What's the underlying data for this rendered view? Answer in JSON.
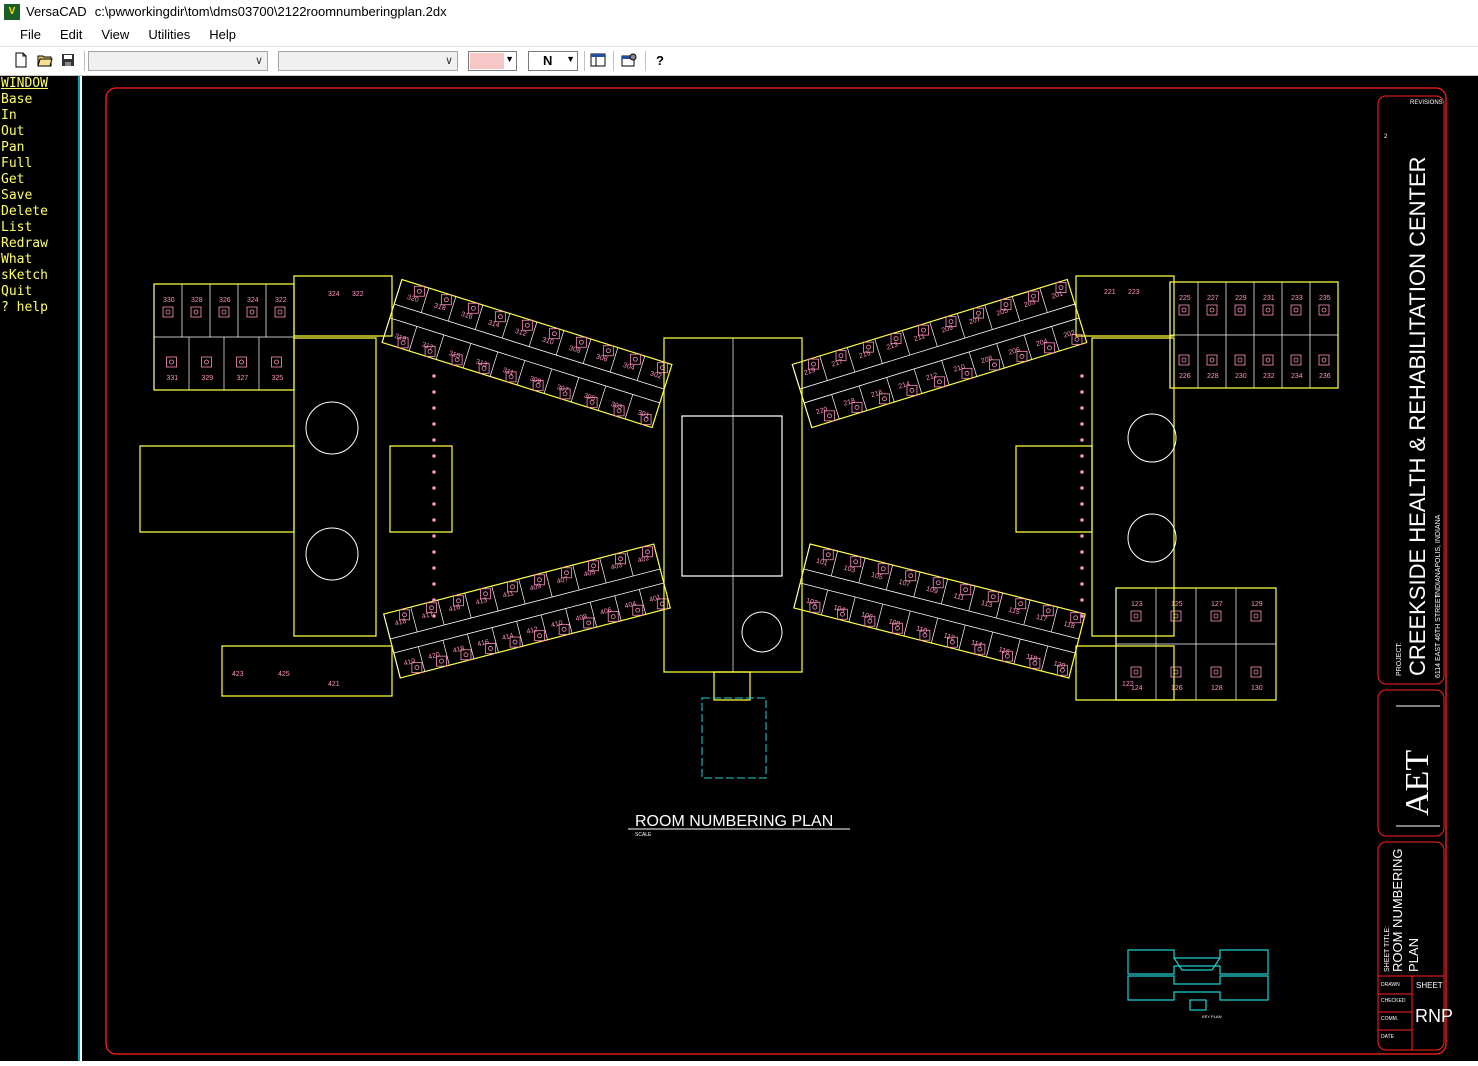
{
  "window": {
    "app_name": "VersaCAD",
    "file_path": "c:\\pwworkingdir\\tom\\dms03700\\2122roomnumberingplan.2dx"
  },
  "menu": [
    "File",
    "Edit",
    "View",
    "Utilities",
    "Help"
  ],
  "toolbar": {
    "layer_select": "",
    "pen_select": "",
    "color_swatch": "#f7c7c7",
    "n_value": "N",
    "icons": [
      "new-file-icon",
      "open-folder-icon",
      "save-icon",
      "layer-table-icon",
      "settings-icon",
      "help-icon"
    ]
  },
  "commands": [
    "WINDOW",
    "Base",
    "In",
    "Out",
    "Pan",
    "Full",
    "Get",
    "Save",
    "Delete",
    "List",
    "Redraw",
    "What",
    "sKetch",
    "Quit",
    "? help"
  ],
  "drawing": {
    "plan_title": "ROOM NUMBERING PLAN",
    "plan_scale_note": "SCALE",
    "project_label": "PROJECT:",
    "project_name": "CREEKSIDE HEALTH & REHABILITATION CENTER",
    "project_address_1": "6114 EAST 46TH STREET",
    "project_address_2": "INDIANAPOLIS, INDIANA",
    "revisions_label": "REVISIONS",
    "revision_mark": "2",
    "firm_logo": "AET",
    "sheet_title_label": "SHEET TITLE:",
    "sheet_title": "ROOM NUMBERING PLAN",
    "sheet_label": "SHEET",
    "sheet_id": "RNP",
    "drawn_label": "DRAWN",
    "checked_label": "CHECKED",
    "comm_label": "COMM.",
    "date_label": "DATE",
    "key_plan_caption": "KEY PLAN",
    "colors": {
      "background": "#000000",
      "border": "#ff2020",
      "walls": "#ffff40",
      "rooms": "#ffffff",
      "fixtures": "#ff90c0",
      "keyplan": "#20d0d0"
    },
    "rooms": {
      "nw_top": [
        "330",
        "328",
        "326",
        "324",
        "322"
      ],
      "nw_low": [
        "331",
        "329",
        "327",
        "325"
      ],
      "wing_300_upper": [
        "320",
        "318",
        "316",
        "314",
        "312",
        "310",
        "308",
        "306",
        "304",
        "302"
      ],
      "wing_300_lower": [
        "319",
        "317",
        "315",
        "313",
        "311",
        "309",
        "307",
        "305",
        "303",
        "301"
      ],
      "wing_200_upper": [
        "219",
        "217",
        "215",
        "213",
        "211",
        "209",
        "207",
        "205",
        "203",
        "201"
      ],
      "wing_200_lower": [
        "220",
        "218",
        "216",
        "214",
        "212",
        "210",
        "208",
        "206",
        "204",
        "202"
      ],
      "ne_top": [
        "221",
        "223",
        "225",
        "227",
        "229",
        "231",
        "233",
        "235"
      ],
      "ne_low": [
        "226",
        "228",
        "230",
        "232",
        "234",
        "236"
      ],
      "wing_400_upper": [
        "418",
        "417",
        "416",
        "413",
        "411",
        "409",
        "407",
        "405",
        "403",
        "402"
      ],
      "wing_400_lower": [
        "419",
        "420",
        "418",
        "416",
        "414",
        "412",
        "410",
        "408",
        "406",
        "404",
        "401"
      ],
      "sw_room": [
        "421",
        "423",
        "425"
      ],
      "wing_100_upper": [
        "101",
        "103",
        "105",
        "107",
        "109",
        "111",
        "113",
        "115",
        "117",
        "118"
      ],
      "wing_100_lower": [
        "102",
        "104",
        "106",
        "108",
        "110",
        "112",
        "114",
        "116",
        "118",
        "120"
      ],
      "se_top": [
        "123",
        "125",
        "127",
        "129"
      ],
      "se_low": [
        "122",
        "124",
        "126",
        "128",
        "130"
      ]
    }
  }
}
